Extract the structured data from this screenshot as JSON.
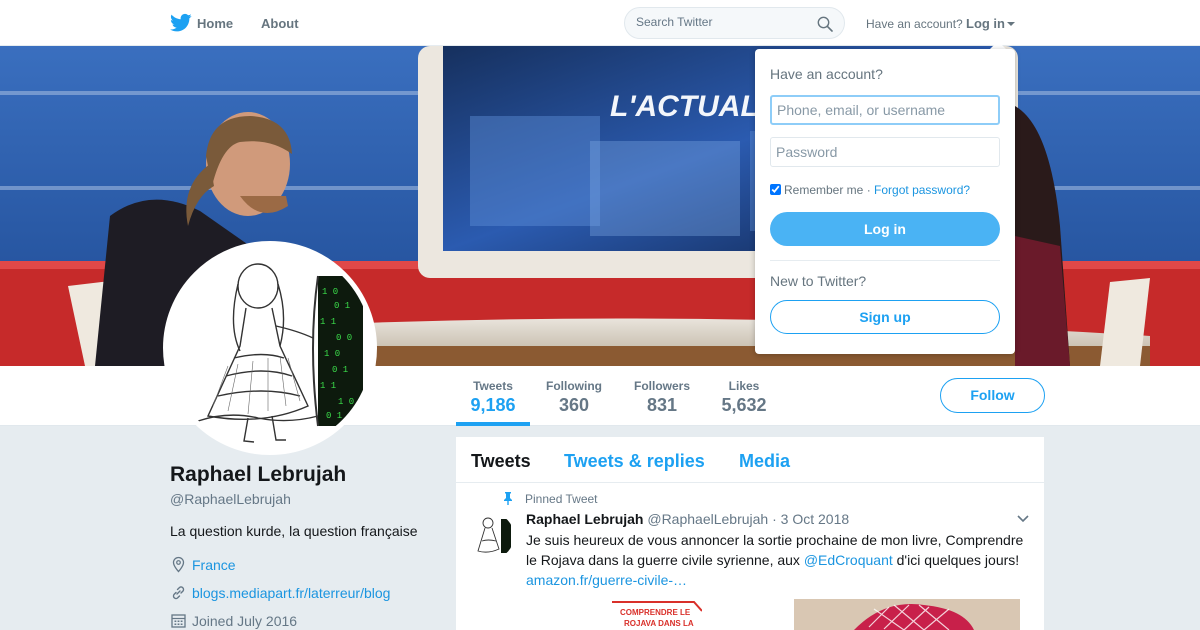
{
  "nav": {
    "home": "Home",
    "about": "About",
    "search_placeholder": "Search Twitter",
    "have_account": "Have an account?",
    "login": "Log in"
  },
  "profile": {
    "name": "Raphael Lebrujah",
    "handle": "@RaphaelLebrujah",
    "bio": "La question kurde, la question française",
    "location": "France",
    "website": "blogs.mediapart.fr/laterreur/blog",
    "joined": "Joined July 2016",
    "follow": "Follow"
  },
  "stats": [
    {
      "label": "Tweets",
      "value": "9,186",
      "active": true
    },
    {
      "label": "Following",
      "value": "360",
      "active": false
    },
    {
      "label": "Followers",
      "value": "831",
      "active": false
    },
    {
      "label": "Likes",
      "value": "5,632",
      "active": false
    }
  ],
  "timeline": {
    "tabs": [
      {
        "label": "Tweets",
        "active": true
      },
      {
        "label": "Tweets & replies",
        "active": false
      },
      {
        "label": "Media",
        "active": false
      }
    ],
    "pinned_label": "Pinned Tweet",
    "tweet": {
      "name": "Raphael Lebrujah",
      "handle": "@RaphaelLebrujah",
      "separator": "·",
      "date": "3 Oct 2018",
      "text_1": "Je suis heureux de vous annoncer la sortie prochaine de mon livre, Comprendre le Rojava dans la guerre civile syrienne, aux ",
      "mention": "@EdCroquant",
      "text_2": " d'ici quelques jours!",
      "link": "amazon.fr/guerre-civile-…",
      "media_1_text_line1": "COMPRENDRE LE",
      "media_1_text_line2": "ROJAVA DANS LA"
    }
  },
  "login_dropdown": {
    "heading": "Have an account?",
    "username_placeholder": "Phone, email, or username",
    "password_placeholder": "Password",
    "remember_me": "Remember me",
    "separator": "·",
    "forgot": "Forgot password?",
    "login_button": "Log in",
    "new_to_twitter": "New to Twitter?",
    "signup_button": "Sign up"
  },
  "banner": {
    "screen_text": "L'ACTUALIT"
  },
  "colors": {
    "accent": "#1da1f2",
    "link": "#1b95e0",
    "login_button": "#4ab3f4",
    "background": "#e6ecf0"
  }
}
